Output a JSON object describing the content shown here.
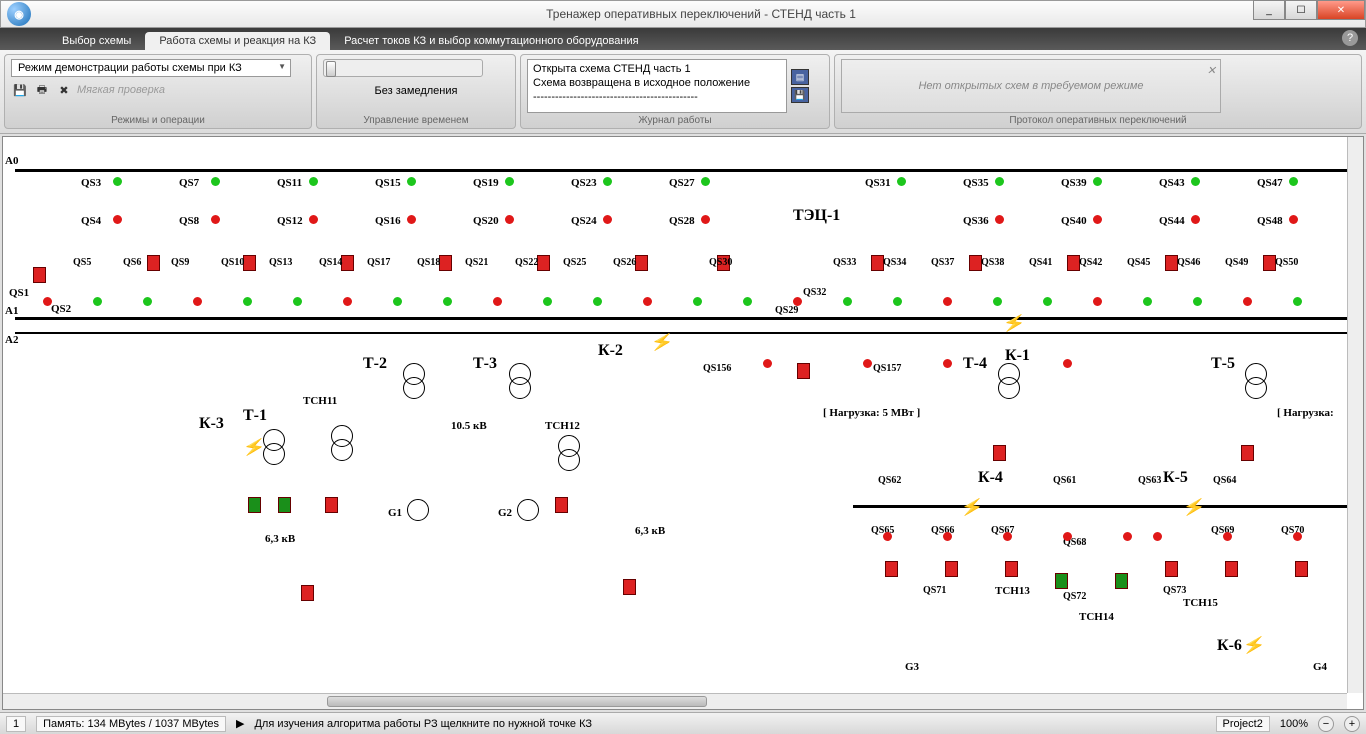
{
  "window": {
    "title": "Тренажер оперативных переключений - СТЕНД часть 1",
    "min": "_",
    "max": "☐",
    "close": "✕"
  },
  "tabs": {
    "t1": "Выбор схемы",
    "t2": "Работа схемы и реакция на КЗ",
    "t3": "Расчет токов КЗ и выбор коммутационного оборудования"
  },
  "ribbon": {
    "mode_dropdown": "Режим демонстрации работы схемы при КЗ",
    "soft_check": "Мягкая проверка",
    "group_modes": "Режимы и операции",
    "no_delay": "Без замедления",
    "group_time": "Управление временем",
    "log_line1": "Открыта схема СТЕНД часть 1",
    "log_line2": "Схема возвращена в исходное положение",
    "log_line3": "---------------------------------------------",
    "group_log": "Журнал работы",
    "no_proto": "Нет открытых схем в требуемом режиме",
    "group_proto": "Протокол оперативных переключений"
  },
  "diagram": {
    "bus_A0": "A0",
    "bus_A1": "A1",
    "bus_A2": "A2",
    "station": "ТЭЦ-1",
    "qs_top": [
      "QS3",
      "QS7",
      "QS11",
      "QS15",
      "QS19",
      "QS23",
      "QS27",
      "QS31",
      "QS35",
      "QS39",
      "QS43",
      "QS47"
    ],
    "qs_top2": [
      "QS4",
      "QS8",
      "QS12",
      "QS16",
      "QS20",
      "QS24",
      "QS28",
      "QS36",
      "QS40",
      "QS44",
      "QS48"
    ],
    "qs_rightext": [
      "QS5",
      "QS5"
    ],
    "qs_pairs_left": [
      "QS5",
      "QS6",
      "QS9",
      "QS10",
      "QS13",
      "QS14",
      "QS17",
      "QS18",
      "QS21",
      "QS22",
      "QS25",
      "QS26",
      "QS30"
    ],
    "qs_pairs_right": [
      "QS33",
      "QS34",
      "QS37",
      "QS38",
      "QS41",
      "QS42",
      "QS45",
      "QS46",
      "QS49",
      "QS50"
    ],
    "qs_bottom_left": [
      "QS1",
      "QS2"
    ],
    "qs_mid": [
      "QS29",
      "QS32",
      "QS156",
      "QS157"
    ],
    "qs_low": [
      "QS61",
      "QS62",
      "QS63",
      "QS64",
      "QS65",
      "QS66",
      "QS67",
      "QS68",
      "QS69",
      "QS70",
      "QS71",
      "QS72",
      "QS73"
    ],
    "T": [
      "Т-1",
      "Т-2",
      "Т-3",
      "Т-4",
      "Т-5"
    ],
    "K": [
      "К-1",
      "К-2",
      "К-3",
      "К-4",
      "К-5",
      "К-6"
    ],
    "G": [
      "G1",
      "G2",
      "G3",
      "G4"
    ],
    "TCH": [
      "ТСН11",
      "ТСН12",
      "ТСН13",
      "ТСН14",
      "ТСН15"
    ],
    "voltages": {
      "v10_5": "10.5 кВ",
      "v6_3a": "6,3 кВ",
      "v6_3b": "6,3 кВ"
    },
    "load": "[ Нагрузка: 5 МВт ]",
    "load2": "[ Нагрузка:"
  },
  "status": {
    "page": "1",
    "memory": "Память: 134 MBytes / 1037 MBytes",
    "hint": "Для изучения алгоритма работы РЗ щелкните по нужной точке КЗ",
    "project": "Project2",
    "zoom": "100%"
  }
}
